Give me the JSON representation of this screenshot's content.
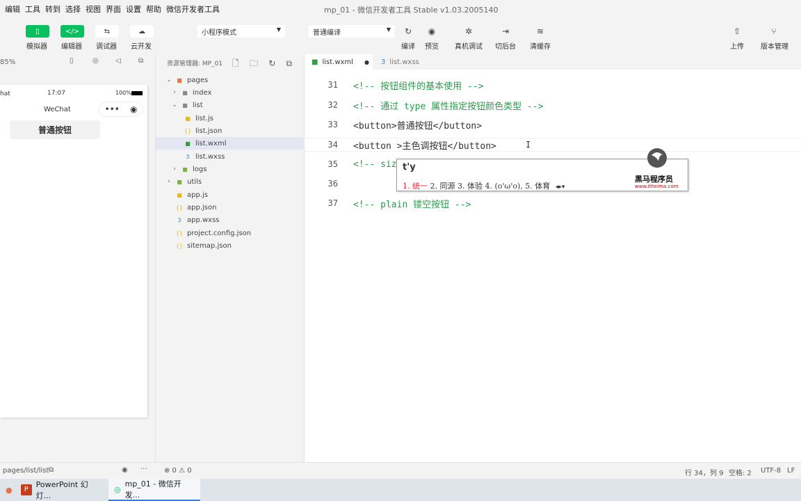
{
  "menu": [
    "编辑",
    "工具",
    "转到",
    "选择",
    "视图",
    "界面",
    "设置",
    "帮助",
    "微信开发者工具"
  ],
  "window_title": "mp_01 - 微信开发者工具 Stable v1.03.2005140",
  "toolbar": {
    "simulator": "模拟器",
    "editor": "编辑器",
    "debugger": "调试器",
    "cloud": "云开发",
    "mode_select": "小程序模式",
    "compile_select": "普通编译",
    "compile": "编译",
    "preview": "预览",
    "remote_debug": "真机调试",
    "background": "切后台",
    "clear_cache": "清缓存",
    "upload": "上传",
    "version": "版本管理"
  },
  "simulator": {
    "zoom": "85%",
    "status_left": "hat",
    "time": "17:07",
    "battery": "100%",
    "nav_title": "WeChat",
    "button_label": "普通按钮"
  },
  "explorer": {
    "title": "资源管理器: MP_01",
    "items": [
      {
        "name": "pages",
        "type": "folder-open"
      },
      {
        "name": "index",
        "type": "folder"
      },
      {
        "name": "list",
        "type": "folder-open"
      },
      {
        "name": "list.js",
        "type": "js"
      },
      {
        "name": "list.json",
        "type": "json"
      },
      {
        "name": "list.wxml",
        "type": "wxml"
      },
      {
        "name": "list.wxss",
        "type": "wxss"
      },
      {
        "name": "logs",
        "type": "folder"
      },
      {
        "name": "utils",
        "type": "folder"
      },
      {
        "name": "app.js",
        "type": "js"
      },
      {
        "name": "app.json",
        "type": "json"
      },
      {
        "name": "app.wxss",
        "type": "wxss"
      },
      {
        "name": "project.config.json",
        "type": "json"
      },
      {
        "name": "sitemap.json",
        "type": "json"
      }
    ]
  },
  "editor": {
    "tabs": [
      "list.wxml",
      "list.wxss"
    ],
    "lines": [
      {
        "no": "31",
        "text": "<!-- 按钮组件的基本使用 -->",
        "comment": true
      },
      {
        "no": "32",
        "text": "<!-- 通过 type 属性指定按钮颜色类型 -->",
        "comment": true
      },
      {
        "no": "33",
        "text": "<button>普通按钮</button>",
        "comment": false
      },
      {
        "no": "34",
        "text": "<button >主色调按钮</button>",
        "comment": false
      },
      {
        "no": "35",
        "text": "<!-- siz",
        "comment": true
      },
      {
        "no": "36",
        "text": "",
        "comment": false
      },
      {
        "no": "37",
        "text": "<!-- plain 镂空按钮 -->",
        "comment": true
      }
    ]
  },
  "ime": {
    "input": "t'y",
    "candidate_first": "1. 统一",
    "candidates_rest": "2. 同源  3. 体验  4. (o'ω'o),  5. 体育",
    "logo_text": "黑马程序员",
    "logo_url": "www.itheima.com"
  },
  "status": {
    "path": "pages/list/list",
    "problems": "⊗ 0 ⚠ 0",
    "position": "行 34，列 9",
    "spaces": "空格: 2",
    "encoding": "UTF-8",
    "eol": "LF"
  },
  "taskbar": {
    "ppt": "PowerPoint 幻灯...",
    "devtools": "mp_01 - 微信开发..."
  },
  "colors": {
    "accent": "#07c160",
    "comment": "#2c9a4c"
  }
}
